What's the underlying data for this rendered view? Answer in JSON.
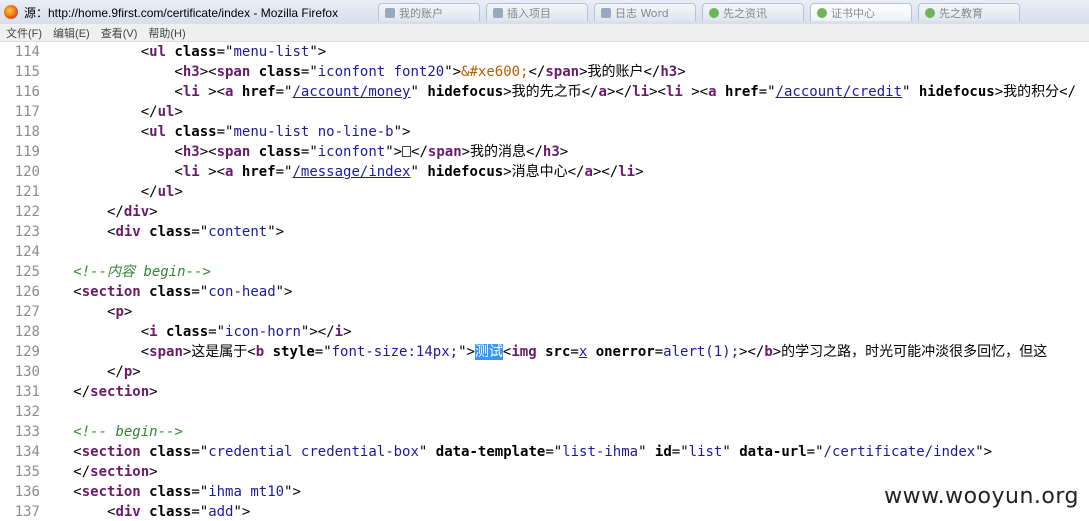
{
  "window": {
    "title": "源：http://home.9first.com/certificate/index - Mozilla Firefox"
  },
  "tabs": [
    {
      "label": "我的账户",
      "icon": "page-icon"
    },
    {
      "label": "插入项目",
      "icon": "page-icon"
    },
    {
      "label": "日志 Word",
      "icon": "page-icon"
    },
    {
      "label": "先之资讯",
      "icon": "globe-icon"
    },
    {
      "label": "证书中心",
      "icon": "globe-icon"
    },
    {
      "label": "先之教育",
      "icon": "globe-icon"
    }
  ],
  "menu": [
    "文件(F)",
    "编辑(E)",
    "查看(V)",
    "帮助(H)"
  ],
  "code_lines": [
    {
      "n": "114",
      "html": "           &lt;<span class='tn'>ul</span> <span class='an'>class</span>=\"<span class='av'>menu-list</span>\"&gt;"
    },
    {
      "n": "115",
      "html": "               &lt;<span class='tn'>h3</span>&gt;&lt;<span class='tn'>span</span> <span class='an'>class</span>=\"<span class='av'>iconfont font20</span>\"&gt;<span class='ent'>&amp;#xe600;</span>&lt;/<span class='tn'>span</span>&gt;我的账户&lt;/<span class='tn'>h3</span>&gt;"
    },
    {
      "n": "116",
      "html": "               &lt;<span class='tn'>li</span> &gt;&lt;<span class='tn'>a</span> <span class='an'>href</span>=\"<span class='link'>/account/money</span>\" <span class='an'>hidefocus</span>&gt;我的先之币&lt;/<span class='tn'>a</span>&gt;&lt;/<span class='tn'>li</span>&gt;&lt;<span class='tn'>li</span> &gt;&lt;<span class='tn'>a</span> <span class='an'>href</span>=\"<span class='link'>/account/credit</span>\" <span class='an'>hidefocus</span>&gt;我的积分&lt;/"
    },
    {
      "n": "117",
      "html": "           &lt;/<span class='tn'>ul</span>&gt;"
    },
    {
      "n": "118",
      "html": "           &lt;<span class='tn'>ul</span> <span class='an'>class</span>=\"<span class='av'>menu-list no-line-b</span>\"&gt;"
    },
    {
      "n": "119",
      "html": "               &lt;<span class='tn'>h3</span>&gt;&lt;<span class='tn'>span</span> <span class='an'>class</span>=\"<span class='av'>iconfont</span>\"&gt;<span class='gi'></span>&lt;/<span class='tn'>span</span>&gt;我的消息&lt;/<span class='tn'>h3</span>&gt;"
    },
    {
      "n": "120",
      "html": "               &lt;<span class='tn'>li</span> &gt;&lt;<span class='tn'>a</span> <span class='an'>href</span>=\"<span class='link'>/message/index</span>\" <span class='an'>hidefocus</span>&gt;消息中心&lt;/<span class='tn'>a</span>&gt;&lt;/<span class='tn'>li</span>&gt;"
    },
    {
      "n": "121",
      "html": "           &lt;/<span class='tn'>ul</span>&gt;"
    },
    {
      "n": "122",
      "html": "       &lt;/<span class='tn'>div</span>&gt;"
    },
    {
      "n": "123",
      "html": "       &lt;<span class='tn'>div</span> <span class='an'>class</span>=\"<span class='av'>content</span>\"&gt;"
    },
    {
      "n": "124",
      "html": ""
    },
    {
      "n": "125",
      "html": "   <span class='cmt'>&lt;!--内容 begin--&gt;</span>"
    },
    {
      "n": "126",
      "html": "   &lt;<span class='tn'>section</span> <span class='an'>class</span>=\"<span class='av'>con-head</span>\"&gt;"
    },
    {
      "n": "127",
      "html": "       &lt;<span class='tn'>p</span>&gt;"
    },
    {
      "n": "128",
      "html": "           &lt;<span class='tn'>i</span> <span class='an'>class</span>=\"<span class='av'>icon-horn</span>\"&gt;&lt;/<span class='tn'>i</span>&gt;"
    },
    {
      "n": "129",
      "html": "           &lt;<span class='tn'>span</span>&gt;这是属于&lt;<span class='tn'>b</span> <span class='an'>style</span>=\"<span class='av'>font-size:14px;</span>\"&gt;<span class='sel'>测试</span>&lt;<span class='tn'>img</span> <span class='an'>src</span>=<span class='link'>x</span> <span class='an'>onerror</span>=<span class='av'>alert(1);</span>&gt;&lt;/<span class='tn'>b</span>&gt;的学习之路，时光可能冲淡很多回忆，但这"
    },
    {
      "n": "130",
      "html": "       &lt;/<span class='tn'>p</span>&gt;"
    },
    {
      "n": "131",
      "html": "   &lt;/<span class='tn'>section</span>&gt;"
    },
    {
      "n": "132",
      "html": ""
    },
    {
      "n": "133",
      "html": "   <span class='cmt'>&lt;!-- begin--&gt;</span>"
    },
    {
      "n": "134",
      "html": "   &lt;<span class='tn'>section</span> <span class='an'>class</span>=\"<span class='av'>credential credential-box</span>\" <span class='an'>data-template</span>=\"<span class='av'>list-ihma</span>\" <span class='an'>id</span>=\"<span class='av'>list</span>\" <span class='an'>data-url</span>=\"<span class='av'>/certificate/index</span>\"&gt;"
    },
    {
      "n": "135",
      "html": "   &lt;/<span class='tn'>section</span>&gt;"
    },
    {
      "n": "136",
      "html": "   &lt;<span class='tn'>section</span> <span class='an'>class</span>=\"<span class='av'>ihma mt10</span>\"&gt;"
    },
    {
      "n": "137",
      "html": "       &lt;<span class='tn'>div</span> <span class='an'>class</span>=\"<span class='av'>add</span>\"&gt;"
    }
  ],
  "watermark": "www.wooyun.org"
}
